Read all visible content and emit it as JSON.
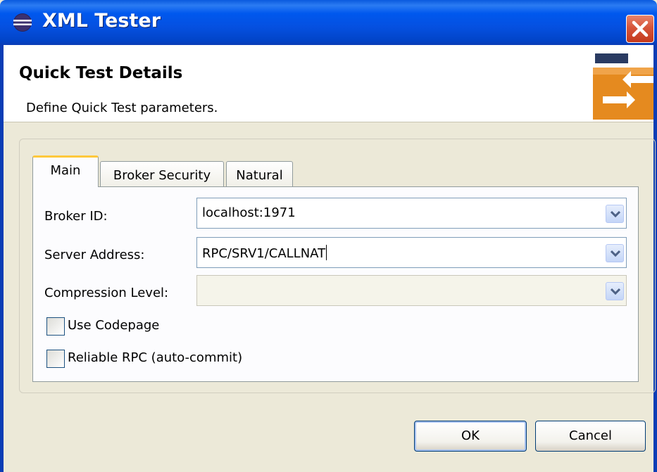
{
  "window": {
    "title": "XML Tester"
  },
  "header": {
    "title": "Quick Test Details",
    "description": "Define Quick Test parameters."
  },
  "tabs": [
    {
      "label": "Main",
      "selected": true
    },
    {
      "label": "Broker Security",
      "selected": false
    },
    {
      "label": "Natural",
      "selected": false
    }
  ],
  "form": {
    "broker_id": {
      "label": "Broker ID:",
      "value": "localhost:1971"
    },
    "server_address": {
      "label": "Server Address:",
      "value": "RPC/SRV1/CALLNAT"
    },
    "compression_level": {
      "label": "Compression Level:",
      "value": ""
    },
    "use_codepage": {
      "label": "Use Codepage",
      "checked": false
    },
    "reliable_rpc": {
      "label": "Reliable RPC (auto-commit)",
      "checked": false
    }
  },
  "buttons": {
    "ok": "OK",
    "cancel": "Cancel"
  },
  "icons": {
    "app": "eclipse-icon",
    "close": "close-icon",
    "banner": "swap-arrows-icon",
    "dropdown": "chevron-down-icon"
  },
  "colors": {
    "titlebar": "#0058EE",
    "close_button": "#D6553A",
    "banner_orange": "#E58A1F",
    "focus_tab": "#FFC83C"
  }
}
